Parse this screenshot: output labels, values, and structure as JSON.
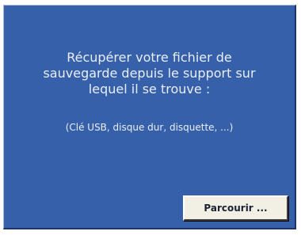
{
  "dialog": {
    "message_lines": [
      "Récupérer votre fichier de",
      "sauvegarde depuis le support sur",
      "lequel il se trouve :"
    ],
    "hint": "(Clé USB, disque dur, disquette, ...)",
    "browse_button_label": "Parcourir ...",
    "background_color": "#3660a9",
    "text_color": "#e9eef8",
    "button_color": "#f2efe4"
  }
}
